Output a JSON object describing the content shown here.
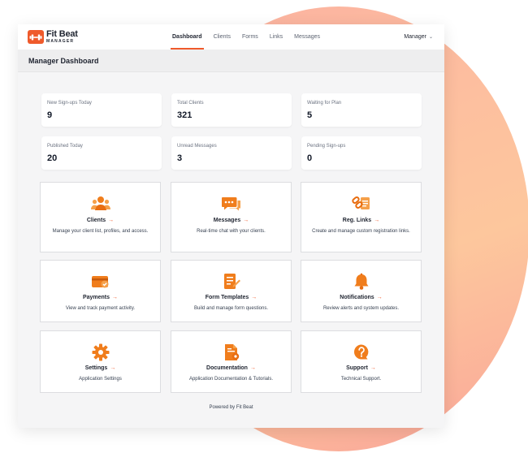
{
  "app": {
    "logo_name": "Fit Beat",
    "logo_sub": "MANAGER"
  },
  "nav": {
    "items": [
      {
        "label": "Dashboard",
        "active": true
      },
      {
        "label": "Clients",
        "active": false
      },
      {
        "label": "Forms",
        "active": false
      },
      {
        "label": "Links",
        "active": false
      },
      {
        "label": "Messages",
        "active": false
      }
    ]
  },
  "user_menu": {
    "label": "Manager",
    "icon": "chevron-down-icon"
  },
  "page": {
    "title": "Manager Dashboard"
  },
  "stats": [
    {
      "label": "New Sign-ups Today",
      "value": "9"
    },
    {
      "label": "Total Clients",
      "value": "321"
    },
    {
      "label": "Waiting for Plan",
      "value": "5"
    },
    {
      "label": "Published Today",
      "value": "20"
    },
    {
      "label": "Unread Messages",
      "value": "3"
    },
    {
      "label": "Pending Sign-ups",
      "value": "0"
    }
  ],
  "cards": [
    {
      "title": "Clients",
      "desc": "Manage your client list, profiles, and access.",
      "icon": "users-icon"
    },
    {
      "title": "Messages",
      "desc": "Real-time chat with your clients.",
      "icon": "chat-icon"
    },
    {
      "title": "Reg. Links",
      "desc": "Create and manage custom registration links.",
      "icon": "link-icon"
    },
    {
      "title": "Payments",
      "desc": "View and track payment activity.",
      "icon": "wallet-icon"
    },
    {
      "title": "Form Templates",
      "desc": "Build and manage form questions.",
      "icon": "form-edit-icon"
    },
    {
      "title": "Notifications",
      "desc": "Review alerts and system updates.",
      "icon": "bell-icon"
    },
    {
      "title": "Settings",
      "desc": "Application Settings",
      "icon": "gear-icon"
    },
    {
      "title": "Documentation",
      "desc": "Application Documentation & Tutorials.",
      "icon": "document-icon"
    },
    {
      "title": "Support",
      "desc": "Technical Support.",
      "icon": "question-icon"
    }
  ],
  "card_arrow": "→",
  "footer": {
    "text": "Powered by Fit Beat"
  },
  "colors": {
    "accent": "#ef5a2b",
    "icon_orange": "#f07d1c",
    "background_circle": "#fdc39f"
  }
}
